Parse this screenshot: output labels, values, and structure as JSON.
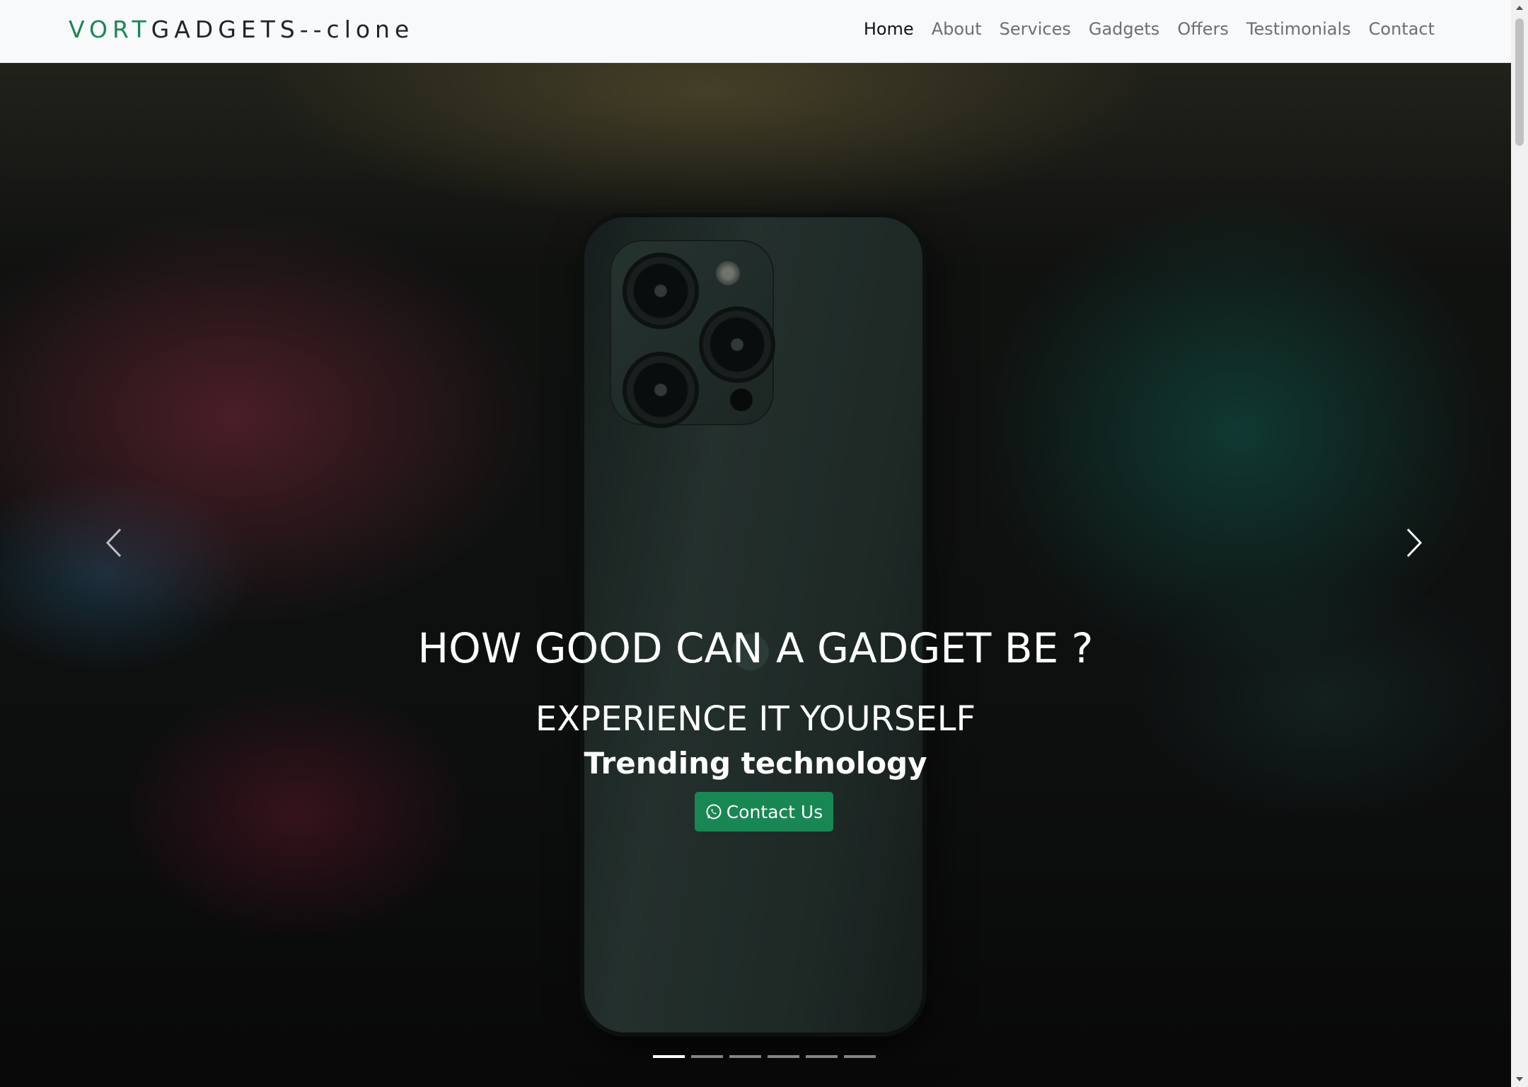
{
  "brand": {
    "accent": "VORT",
    "rest": "GADGETS--clone"
  },
  "nav": {
    "items": [
      {
        "label": "Home",
        "active": true
      },
      {
        "label": "About"
      },
      {
        "label": "Services"
      },
      {
        "label": "Gadgets"
      },
      {
        "label": "Offers"
      },
      {
        "label": "Testimonials"
      },
      {
        "label": "Contact"
      }
    ]
  },
  "hero": {
    "headline": "HOW GOOD CAN A GADGET BE ?",
    "subline": "EXPERIENCE IT YOURSELF",
    "tagline": "Trending technology",
    "cta_label": "Contact Us",
    "cta_icon": "whatsapp-icon",
    "prev_icon": "chevron-left-icon",
    "next_icon": "chevron-right-icon",
    "slides_count": 6,
    "active_slide": 1
  },
  "colors": {
    "accent": "#198754",
    "navbar_bg": "#f8f9fa",
    "nav_text": "#6c6f73"
  }
}
